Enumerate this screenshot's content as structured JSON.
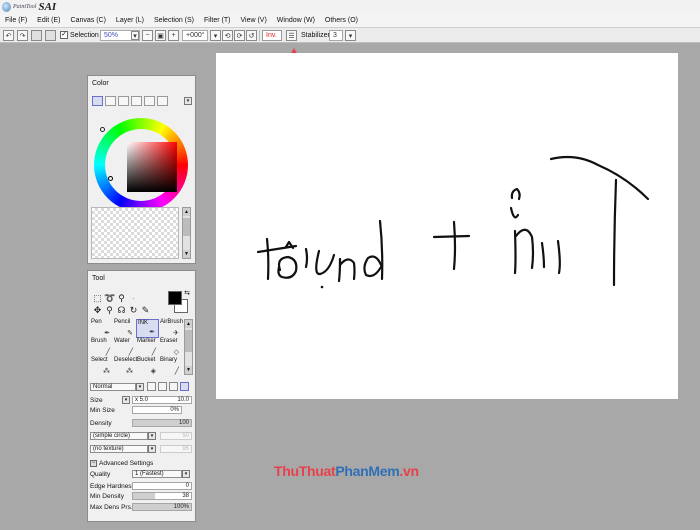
{
  "app": {
    "logo_small": "PaintTool",
    "logo_large": "SAI"
  },
  "menu": [
    {
      "label": "File (F)"
    },
    {
      "label": "Edit (E)"
    },
    {
      "label": "Canvas (C)"
    },
    {
      "label": "Layer (L)"
    },
    {
      "label": "Selection (S)"
    },
    {
      "label": "Filter (T)"
    },
    {
      "label": "View (V)"
    },
    {
      "label": "Window (W)"
    },
    {
      "label": "Others (O)"
    }
  ],
  "toolbar": {
    "selection_label": "Selection",
    "selection_checked": true,
    "zoom": "50%",
    "rotation": "+000°",
    "invert_label": "Inv.",
    "stabilizer_label": "Stabilizer",
    "stabilizer_value": "3"
  },
  "color_panel": {
    "title": "Color"
  },
  "tool_panel": {
    "title": "Tool",
    "brushes": [
      "Pen",
      "Pencil",
      "INK",
      "AirBrush",
      "Brush",
      "Water",
      "Marker",
      "Eraser",
      "Select",
      "Deselect",
      "Bucket",
      "Binary"
    ],
    "selected_brush": "INK",
    "blend_mode": "Normal",
    "size_label": "Size",
    "size_multiplier": "x 5.0",
    "size_value": "10.0",
    "min_size_label": "Min Size",
    "min_size_value": "0%",
    "density_label": "Density",
    "density_value": "100",
    "shape": "(simple circle)",
    "shape_value": "50",
    "texture": "(no texture)",
    "texture_value": "95",
    "advanced_label": "Advanced Settings",
    "quality_label": "Quality",
    "quality_value": "1 (Fastest)",
    "edge_label": "Edge Hardness",
    "edge_value": "0",
    "min_density_label": "Min Density",
    "min_density_value": "38",
    "max_dens_label": "Max Dens Prs.",
    "max_dens_value": "100%"
  },
  "canvas": {
    "handwriting": "tôi học vẽ"
  },
  "colors": {
    "accent_selection": "#6a6fc8",
    "canvas_bg": "#ffffff",
    "workspace_bg": "#a8a8a8",
    "annotation_arrow": "#e8414a"
  },
  "watermark": {
    "part1": "ThuThuat",
    "part2": "PhanMem",
    "part3": ".vn"
  }
}
